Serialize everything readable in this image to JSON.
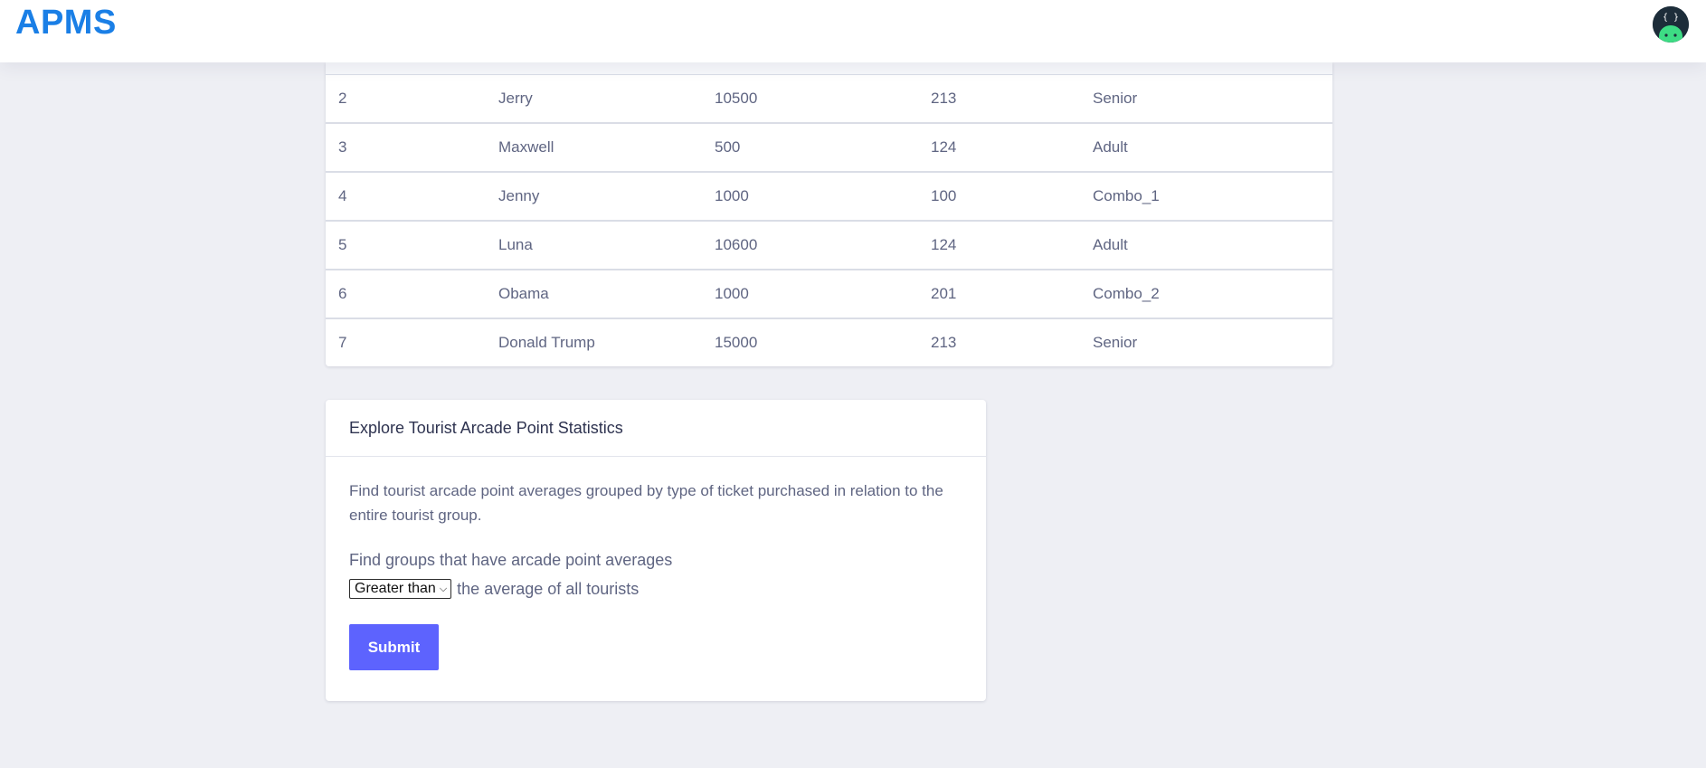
{
  "app": {
    "brand": "APMS"
  },
  "header": {
    "avatar_icon": "android-avatar-icon"
  },
  "table": {
    "rows": [
      [
        "2",
        "Jerry",
        "10500",
        "213",
        "Senior"
      ],
      [
        "3",
        "Maxwell",
        "500",
        "124",
        "Adult"
      ],
      [
        "4",
        "Jenny",
        "1000",
        "100",
        "Combo_1"
      ],
      [
        "5",
        "Luna",
        "10600",
        "124",
        "Adult"
      ],
      [
        "6",
        "Obama",
        "1000",
        "201",
        "Combo_2"
      ],
      [
        "7",
        "Donald Trump",
        "15000",
        "213",
        "Senior"
      ]
    ]
  },
  "stats": {
    "title": "Explore Tourist Arcade Point Statistics",
    "description": "Find tourist arcade point averages grouped by type of ticket purchased in relation to the entire tourist group.",
    "find_label": "Find groups that have arcade point averages",
    "select_value": "Greater than",
    "compare_suffix": "the average of all tourists",
    "submit_label": "Submit"
  },
  "colors": {
    "brand": "#1a7fe6",
    "background": "#eeeff4",
    "submit": "#5d63fe"
  }
}
